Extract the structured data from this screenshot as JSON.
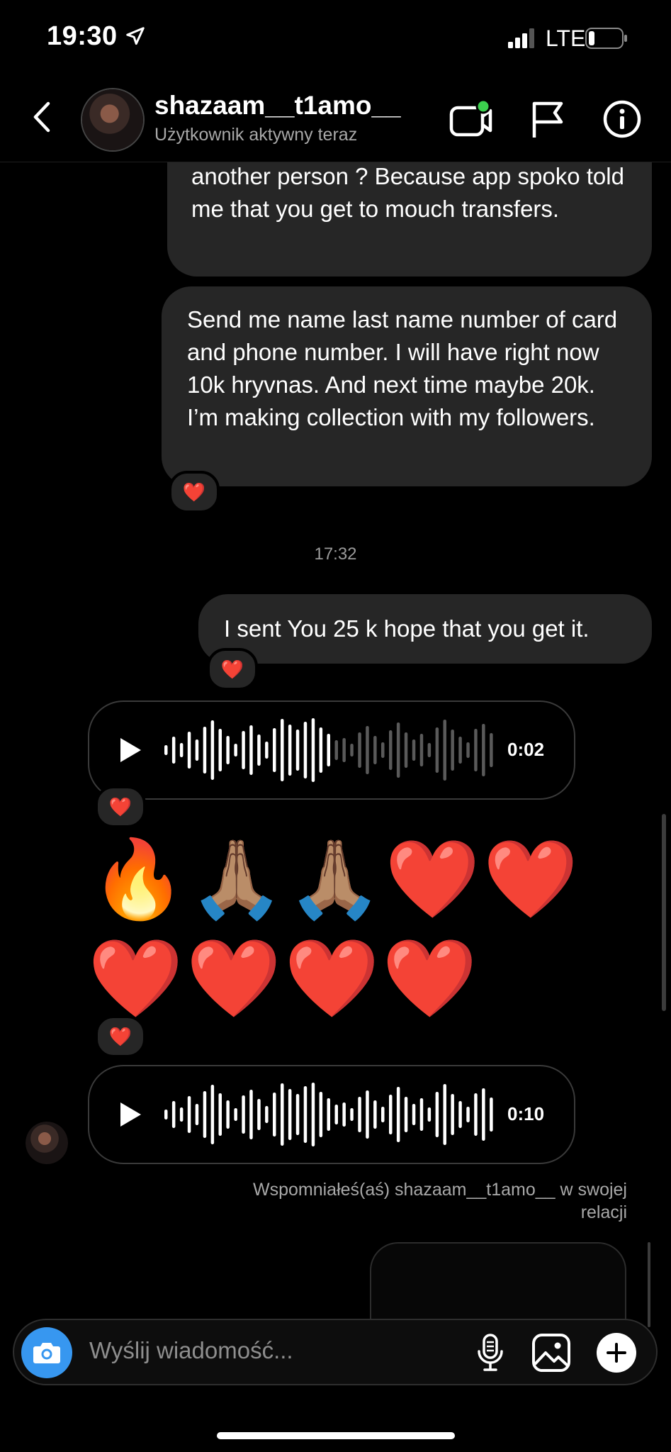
{
  "status_bar": {
    "time": "19:30",
    "network": "LTE",
    "icons": [
      "location-arrow-icon",
      "signal-icon",
      "battery-icon"
    ]
  },
  "header": {
    "username": "shazaam__t1amo__",
    "status_line": "Użytkownik aktywny teraz",
    "icons": [
      "back-chevron-icon",
      "video-call-icon",
      "flag-icon",
      "info-icon"
    ],
    "online_dot_color": "#3ccf4e"
  },
  "messages": {
    "msg1_text": "another person ? Because app spoko told me that you get to mouch transfers.",
    "msg2_text": "Send me name last name number of card and phone number. I will have right now 10k hryvnas. And next time maybe 20k. I’m making collection with my followers.",
    "timestamp": "17:32",
    "msg3_text": "I sent You 25 k hope that you get it.",
    "reaction_emoji": "❤️",
    "voice1_duration": "0:02",
    "voice1_progress": 0.5,
    "emoji_row1": "🔥🙏🏽🙏🏽❤️❤️",
    "emoji_row2": "❤️❤️❤️❤️",
    "voice2_duration": "0:10",
    "voice2_progress": 1.0,
    "mention_text": "Wspomniałeś(aś) shazaam__t1amo__ w swojej relacji"
  },
  "composer": {
    "placeholder": "Wyślij wiadomość...",
    "icons": [
      "camera-icon",
      "microphone-icon",
      "gallery-icon",
      "plus-icon"
    ],
    "camera_color": "#3797f0"
  },
  "colors": {
    "background": "#000000",
    "bubble": "#262626",
    "secondary_text": "#a8a8a8"
  }
}
